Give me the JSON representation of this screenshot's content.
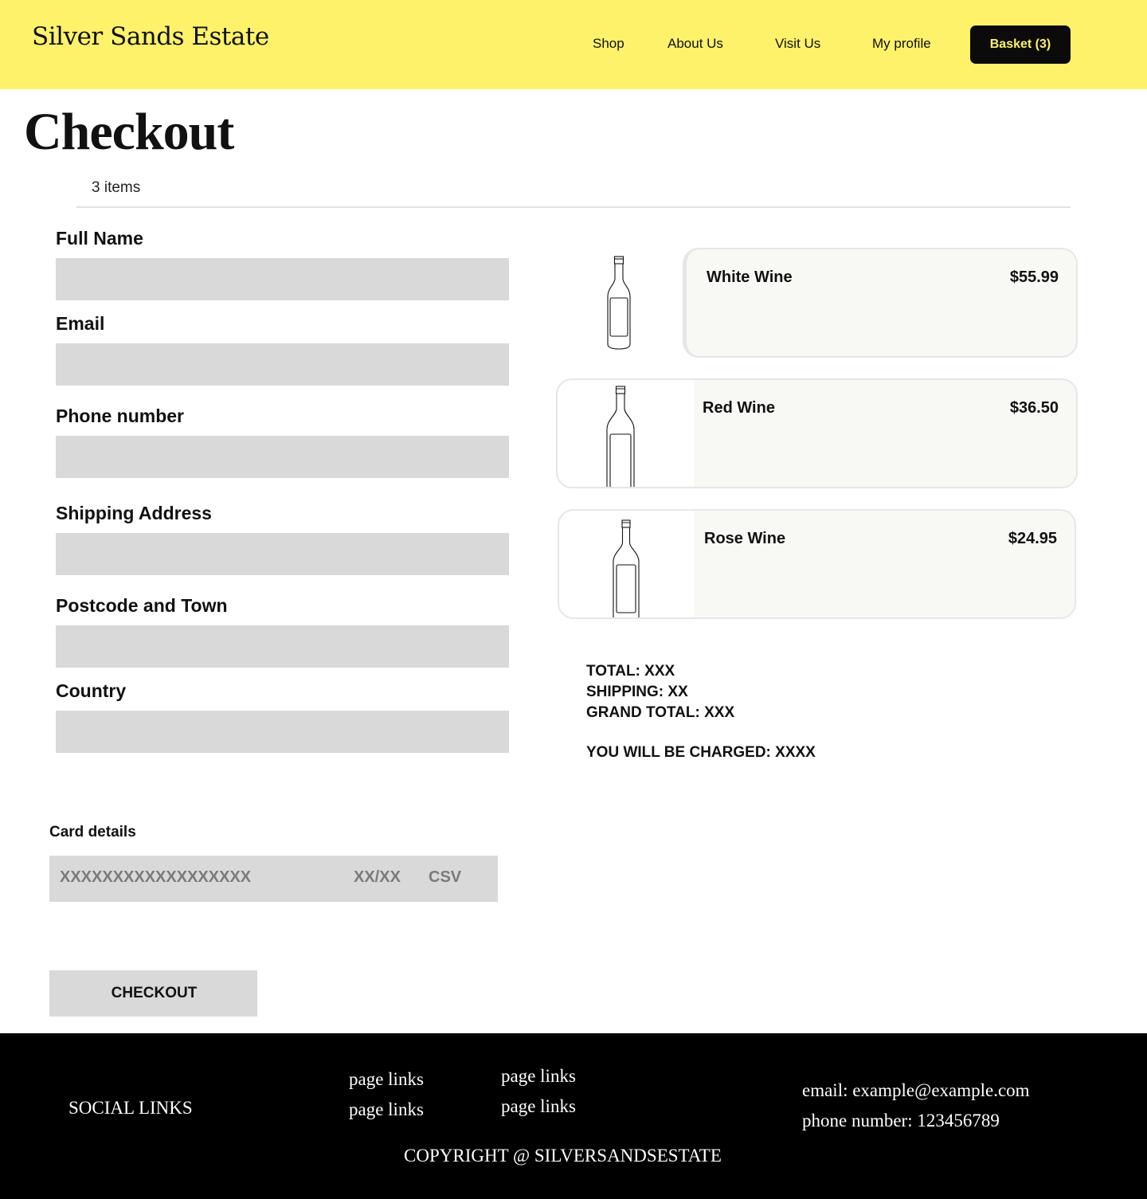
{
  "header": {
    "brand": "Silver Sands Estate",
    "nav": [
      "Shop",
      "About Us",
      "Visit Us",
      "My profile"
    ],
    "basket_label": "Basket (3)",
    "bg_color": "#fef26b",
    "basket_text_color": "#fef26b"
  },
  "page": {
    "title": "Checkout",
    "items_count": "3 items"
  },
  "form": {
    "fields": [
      {
        "label": "Full Name",
        "value": ""
      },
      {
        "label": "Email",
        "value": ""
      },
      {
        "label": "Phone number",
        "value": ""
      },
      {
        "label": "Shipping Address",
        "value": ""
      },
      {
        "label": "Postcode and Town",
        "value": ""
      },
      {
        "label": "Country",
        "value": ""
      }
    ]
  },
  "cart": {
    "items": [
      {
        "name": "White Wine",
        "price": "$55.99",
        "icon": "wine-bottle-icon"
      },
      {
        "name": "Red Wine",
        "price": "$36.50",
        "icon": "wine-bottle-icon"
      },
      {
        "name": "Rose Wine",
        "price": "$24.95",
        "icon": "wine-bottle-icon"
      }
    ],
    "total": "TOTAL: XXX",
    "shipping": "SHIPPING: XX",
    "grand_total": "GRAND TOTAL: XXX",
    "charged": "YOU WILL BE CHARGED: XXXX"
  },
  "card": {
    "label": "Card details",
    "number_placeholder": "XXXXXXXXXXXXXXXXXX",
    "expiry_placeholder": "XX/XX",
    "csv_placeholder": "CSV"
  },
  "checkout_label": "CHECKOUT",
  "footer": {
    "social": "SOCIAL LINKS",
    "links_col1": [
      "page links",
      "page links"
    ],
    "links_col2": [
      "page links",
      "page links"
    ],
    "email": "email: example@example.com",
    "phone": "phone number: 123456789",
    "copyright": "COPYRIGHT @ SILVERSANDSESTATE"
  }
}
